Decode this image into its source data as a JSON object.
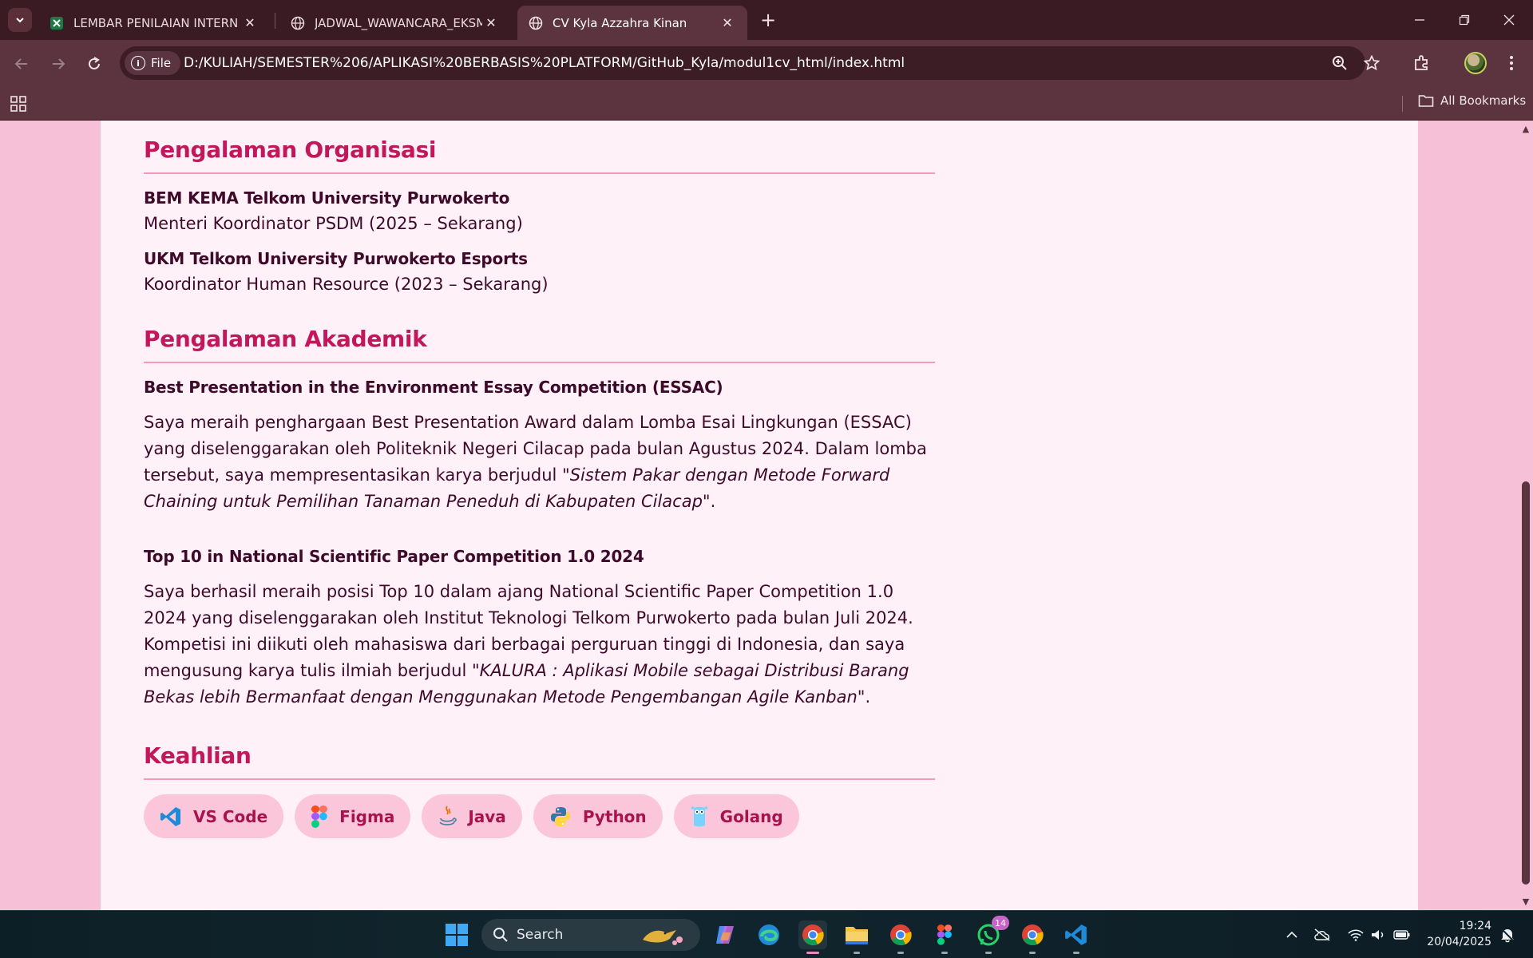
{
  "browser": {
    "tabs": [
      {
        "title": "LEMBAR PENILAIAN INTERN BE",
        "favicon": "excel-icon",
        "active": false
      },
      {
        "title": "JADWAL_WAWANCARA_EKSMU",
        "favicon": "globe-icon",
        "active": false
      },
      {
        "title": "CV Kyla Azzahra Kinan",
        "favicon": "globe-icon",
        "active": true
      }
    ],
    "address": {
      "scheme_chip": "File",
      "url": "D:/KULIAH/SEMESTER%206/APLIKASI%20BERBASIS%20PLATFORM/GitHub_Kyla/modul1cv_html/index.html"
    },
    "bookmarks": {
      "all_label": "All Bookmarks"
    }
  },
  "cv": {
    "organisasi": {
      "title": "Pengalaman Organisasi",
      "items": [
        {
          "name": "BEM KEMA Telkom University Purwokerto",
          "role": "Menteri Koordinator PSDM (2025 – Sekarang)"
        },
        {
          "name": "UKM Telkom University Purwokerto Esports",
          "role": "Koordinator Human Resource (2023 – Sekarang)"
        }
      ]
    },
    "akademik": {
      "title": "Pengalaman Akademik",
      "items": [
        {
          "title": "Best Presentation in the Environment Essay Competition (ESSAC)",
          "text": "Saya meraih penghargaan Best Presentation Award dalam Lomba Esai Lingkungan (ESSAC) yang diselenggarakan oleh Politeknik Negeri Cilacap pada bulan Agustus 2024. Dalam lomba tersebut, saya mempresentasikan karya berjudul ",
          "work": "\"Sistem Pakar dengan Metode Forward Chaining untuk Pemilihan Tanaman Peneduh di Kabupaten Cilacap\"",
          "end": "."
        },
        {
          "title": "Top 10 in National Scientific Paper Competition 1.0 2024",
          "text": "Saya berhasil meraih posisi Top 10 dalam ajang National Scientific Paper Competition 1.0 2024 yang diselenggarakan oleh Institut Teknologi Telkom Purwokerto pada bulan Juli 2024. Kompetisi ini diikuti oleh mahasiswa dari berbagai perguruan tinggi di Indonesia, dan saya mengusung karya tulis ilmiah berjudul ",
          "work": "\"KALURA : Aplikasi Mobile sebagai Distribusi Barang Bekas lebih Bermanfaat dengan Menggunakan Metode Pengembangan Agile Kanban\"",
          "end": "."
        }
      ]
    },
    "keahlian": {
      "title": "Keahlian",
      "skills": [
        {
          "label": "VS Code",
          "icon": "vscode-icon"
        },
        {
          "label": "Figma",
          "icon": "figma-icon"
        },
        {
          "label": "Java",
          "icon": "java-icon"
        },
        {
          "label": "Python",
          "icon": "python-icon"
        },
        {
          "label": "Golang",
          "icon": "golang-icon"
        }
      ]
    }
  },
  "taskbar": {
    "search_label": "Search",
    "whatsapp_badge": "14",
    "time": "19:24",
    "date": "20/04/2025"
  },
  "colors": {
    "accent": "#c2185b",
    "page_bg": "#f6c1d6",
    "card_bg": "#fff1f7",
    "chrome_frame": "#3a1a23",
    "chrome_toolbar": "#5b3440"
  }
}
